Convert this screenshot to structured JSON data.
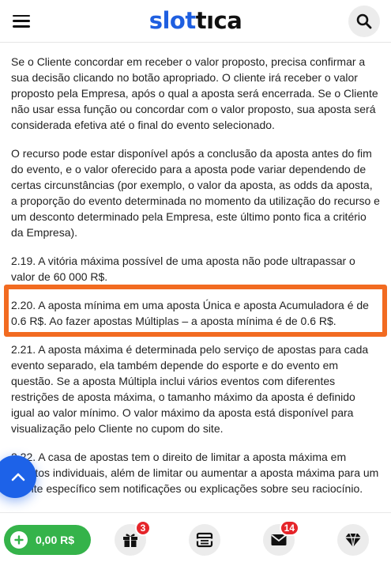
{
  "header": {
    "logo_part1": "slot",
    "logo_part2": "tıca",
    "icons": [
      "menu-icon",
      "search-icon"
    ]
  },
  "content": {
    "paragraphs": [
      "Se o Cliente concordar em receber o valor proposto, precisa confirmar a sua decisão clicando no botão apropriado. O cliente irá receber o valor proposto pela Empresa, após o qual a aposta será encerrada. Se o Cliente não usar essa função ou concordar com o valor proposto, sua aposta será considerada efetiva até o final do evento selecionado.",
      "O recurso pode estar disponível após a conclusão da aposta antes do fim do evento, e o valor oferecido para a aposta pode variar dependendo de certas circunstâncias (por exemplo, o valor da aposta, as odds da aposta, a proporção do evento determinada no momento da utilização do recurso e um desconto determinado pela Empresa, este último ponto fica a critério da Empresa).",
      "2.19. A vitória máxima possível de uma aposta não pode ultrapassar o valor de 60 000 R$.",
      "2.20. A aposta mínima em uma aposta Única e aposta Acumuladora é de 0.6 R$. Ao fazer apostas Múltiplas – a aposta mínima é de 0.6 R$.",
      "2.21. A aposta máxima é determinada pelo serviço de apostas para cada evento separado, ela também depende do esporte e do evento em questão. Se a aposta Múltipla inclui vários eventos com diferentes restrições de aposta máxima, o tamanho máximo da aposta é definido igual ao valor mínimo. O valor máximo da aposta está disponível para visualização pelo Cliente no cupom do site.",
      "2.22. A casa de apostas tem o direito de limitar a aposta máxima em eventos individuais, além de limitar ou aumentar a aposta máxima para um cliente específico sem notificações ou explicações sobre seu raciocínio."
    ],
    "highlight_color": "#f26b21"
  },
  "bottom_bar": {
    "balance": "0,00 R$",
    "gifts_badge": "3",
    "messages_badge": "14",
    "balance_color": "#35b34a",
    "badge_color": "#e5252a",
    "icons": [
      "plus-icon",
      "gift-icon",
      "ticket-icon",
      "mail-icon",
      "diamond-icon"
    ]
  },
  "fab": {
    "icon": "chevron-up-icon",
    "color": "#1d62e8"
  }
}
